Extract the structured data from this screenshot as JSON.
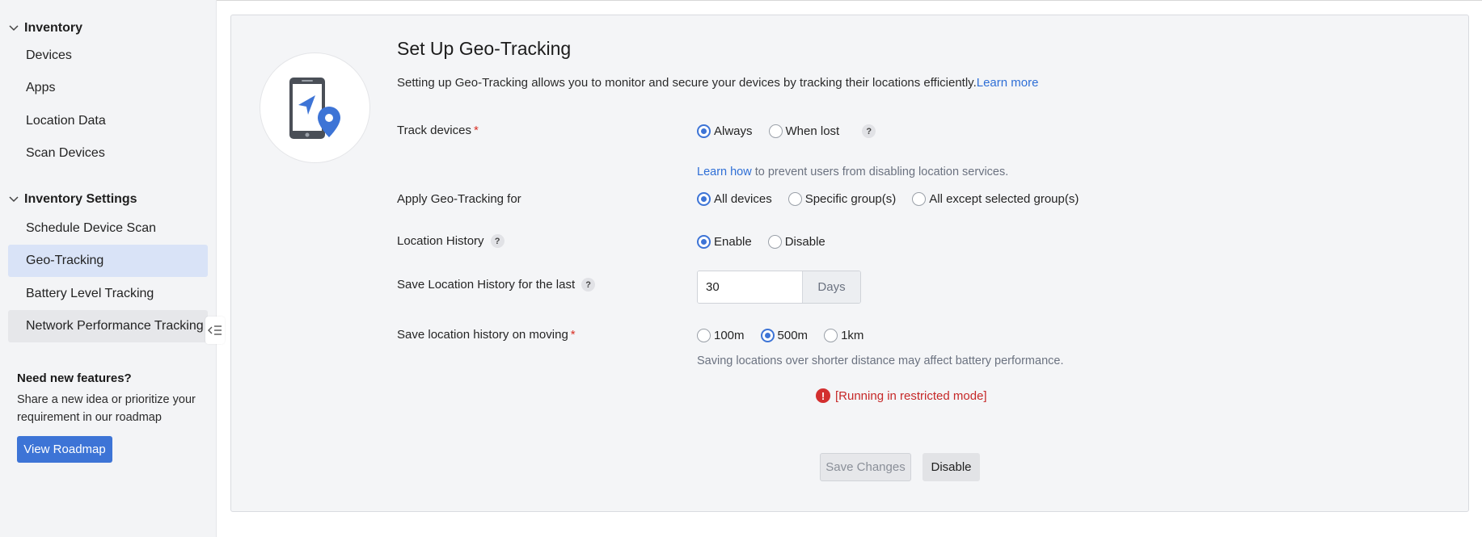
{
  "sidebar": {
    "sections": [
      {
        "title": "Inventory",
        "items": [
          {
            "label": "Devices"
          },
          {
            "label": "Apps"
          },
          {
            "label": "Location Data"
          },
          {
            "label": "Scan Devices"
          }
        ]
      },
      {
        "title": "Inventory Settings",
        "items": [
          {
            "label": "Schedule Device Scan"
          },
          {
            "label": "Geo-Tracking",
            "active": true
          },
          {
            "label": "Battery Level Tracking"
          },
          {
            "label": "Network Performance Tracking"
          }
        ]
      }
    ],
    "promo": {
      "title": "Need new features?",
      "text": "Share a new idea or prioritize your requirement in our roadmap",
      "button": "View Roadmap"
    }
  },
  "panel": {
    "title": "Set Up Geo-Tracking",
    "description": "Setting up Geo-Tracking allows you to monitor and secure your devices by tracking their locations efficiently.",
    "learn_more": "Learn more",
    "track_devices": {
      "label": "Track devices",
      "required": "*",
      "options": [
        "Always",
        "When lost"
      ],
      "selected": "Always",
      "help": "?",
      "hint_link": "Learn how",
      "hint_text": " to prevent users from disabling location services."
    },
    "apply_for": {
      "label": "Apply Geo-Tracking for",
      "options": [
        "All devices",
        "Specific group(s)",
        "All except selected group(s)"
      ],
      "selected": "All devices"
    },
    "location_history": {
      "label": "Location History",
      "help": "?",
      "options": [
        "Enable",
        "Disable"
      ],
      "selected": "Enable"
    },
    "save_history": {
      "label": "Save Location History for the last",
      "help": "?",
      "value": "30",
      "unit": "Days"
    },
    "save_on_moving": {
      "label": "Save location history on moving",
      "required": "*",
      "options": [
        "100m",
        "500m",
        "1km"
      ],
      "selected": "500m",
      "hint": "Saving locations over shorter distance may affect battery performance."
    },
    "warning": {
      "icon": "!",
      "text": "[Running in restricted mode]"
    },
    "buttons": {
      "save": "Save Changes",
      "disable": "Disable"
    }
  },
  "colors": {
    "accent": "#3d74d6",
    "active_nav": "#d9e3f7",
    "error": "#c62828",
    "panel_bg": "#f4f5f7"
  }
}
